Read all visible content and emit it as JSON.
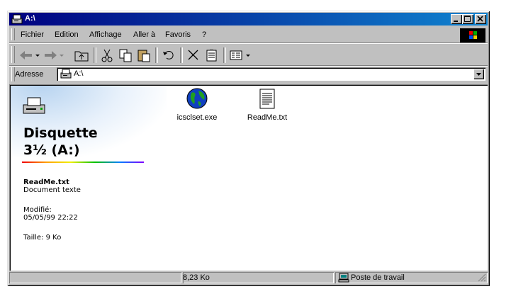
{
  "window": {
    "title": "A:\\"
  },
  "menu": [
    {
      "label": "Fichier"
    },
    {
      "label": "Edition"
    },
    {
      "label": "Affichage"
    },
    {
      "label": "Aller à"
    },
    {
      "label": "Favoris"
    },
    {
      "label": "?"
    }
  ],
  "toolbar": {
    "buttons": [
      "back-icon",
      "forward-icon",
      "up-folder-icon",
      "cut-icon",
      "copy-icon",
      "paste-icon",
      "undo-icon",
      "delete-icon",
      "properties-icon",
      "views-icon"
    ]
  },
  "address": {
    "label": "Adresse",
    "value": "A:\\"
  },
  "panel": {
    "title_line1": "Disquette",
    "title_line2": "3½ (A:)",
    "file_name": "ReadMe.txt",
    "file_type": "Document texte",
    "modified_label": "Modifié:",
    "modified_value": "05/05/99 22:22",
    "size_label": "Taille: 9 Ko"
  },
  "files": [
    {
      "name": "icsclset.exe",
      "icon": "globe-exe-icon"
    },
    {
      "name": "ReadMe.txt",
      "icon": "text-document-icon"
    }
  ],
  "status": {
    "left": "",
    "size": "8,23 Ko",
    "zone": "Poste de travail"
  },
  "colors": {
    "titlebar_start": "#000080",
    "titlebar_end": "#1084d0",
    "chrome": "#c0c0c0"
  }
}
